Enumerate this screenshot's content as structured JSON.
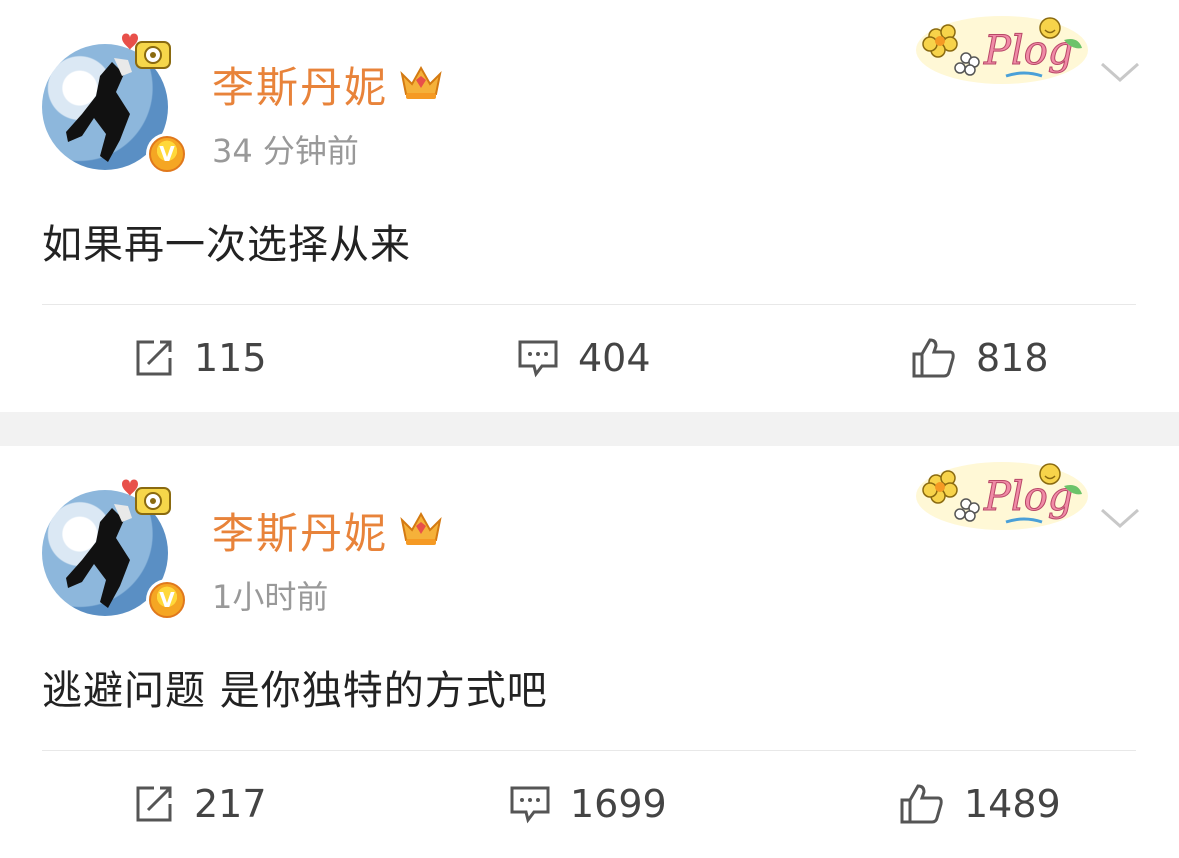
{
  "colors": {
    "name": "#e8833a",
    "time": "#999999",
    "text": "#222222",
    "separator": "#f2f2f2"
  },
  "posts": [
    {
      "author": "李斯丹妮",
      "time": "34 分钟前",
      "content": "如果再一次选择从来",
      "repost_count": "115",
      "comment_count": "404",
      "like_count": "818",
      "badge": "Plog"
    },
    {
      "author": "李斯丹妮",
      "time": "1小时前",
      "content": "逃避问题 是你独特的方式吧",
      "repost_count": "217",
      "comment_count": "1699",
      "like_count": "1489",
      "badge": "Plog"
    }
  ],
  "icons": {
    "verified": "verified-v-icon",
    "crown": "crown-icon",
    "more": "chevron-down-icon",
    "repost": "repost-icon",
    "comment": "comment-icon",
    "like": "thumbs-up-icon"
  }
}
